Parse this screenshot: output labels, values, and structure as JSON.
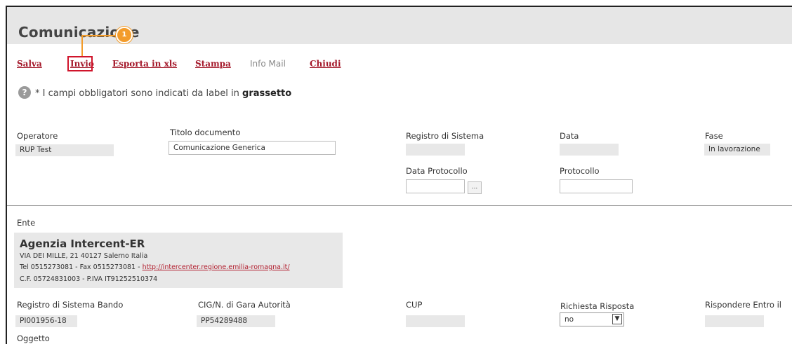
{
  "page": {
    "title": "Comunicazione",
    "callout_number": "1"
  },
  "toolbar": {
    "salva": "Salva",
    "invio": "Invio",
    "esporta": "Esporta in xls",
    "stampa": "Stampa",
    "info_mail": "Info Mail",
    "chiudi": "Chiudi"
  },
  "info": {
    "icon": "?",
    "prefix": "* I campi obbligatori sono indicati da label in ",
    "bold": "grassetto"
  },
  "fields": {
    "operatore": {
      "label": "Operatore",
      "value": "RUP Test"
    },
    "titolo": {
      "label": "Titolo documento",
      "value": "Comunicazione Generica"
    },
    "registro": {
      "label": "Registro di Sistema",
      "value": ""
    },
    "data": {
      "label": "Data",
      "value": ""
    },
    "fase": {
      "label": "Fase",
      "value": "In lavorazione"
    },
    "data_protocollo": {
      "label": "Data Protocollo",
      "value": "",
      "button": "..."
    },
    "protocollo": {
      "label": "Protocollo",
      "value": ""
    }
  },
  "ente": {
    "label": "Ente",
    "name": "Agenzia Intercent-ER",
    "address": "VIA DEI MILLE, 21 40127 Salerno Italia",
    "contacts_prefix": "Tel 0515273081 - Fax 0515273081 - ",
    "url": "http://intercenter.regione.emilia-romagna.it/",
    "fiscal": "C.F. 05724831003 - P.IVA IT91252510374"
  },
  "bando": {
    "registro": {
      "label": "Registro di Sistema Bando",
      "value": "PI001956-18"
    },
    "cig": {
      "label": "CIG/N. di Gara Autorità",
      "value": "PP54289488"
    },
    "cup": {
      "label": "CUP",
      "value": ""
    },
    "richiesta": {
      "label": "Richiesta Risposta",
      "value": "no"
    },
    "rispondere": {
      "label": "Rispondere Entro il",
      "value": ""
    }
  },
  "oggetto": {
    "label": "Oggetto"
  },
  "colors": {
    "accent_link": "#a4182a",
    "highlight": "#d0142b",
    "callout": "#f39c2b"
  }
}
